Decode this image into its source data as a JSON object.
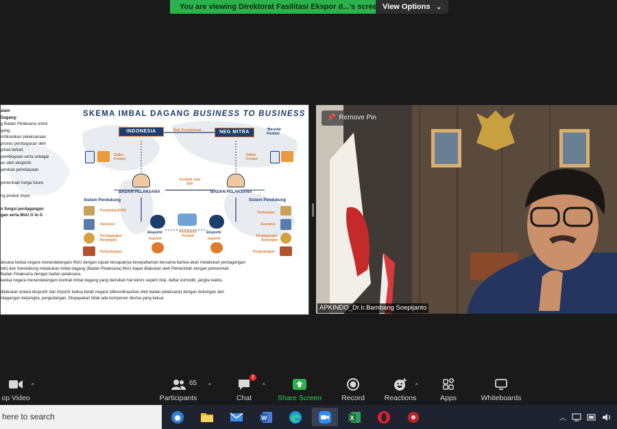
{
  "banner": {
    "message": "You are viewing Direktorat Fasilitasi Ekspor d...'s screen",
    "view_options": "View Options",
    "colors": {
      "green": "#2bb24c"
    }
  },
  "slide": {
    "title_main": "SKEMA IMBAL DAGANG ",
    "title_italic": "BUSINESS TO BUSINESS",
    "left_text": [
      "alam",
      "Dagang:",
      "g Badan Pelaksana untuk",
      "gang.",
      "ordinasikan pelaksanaan",
      "proses pembayaran oleh",
      "pihak terkait.",
      "pembiayaan serta sebagai",
      "an oleh eksportir.",
      "jaminan pembiayaan",
      "",
      "penentuan harga future",
      "",
      "ng produk impor",
      "",
      "n fungsi perdagangan",
      "gan serta MoU G to G"
    ],
    "box_indonesia": "INDONESIA",
    "box_negmitra": "NEG MITRA",
    "label_mou": "MoU Kondisional",
    "label_bersifat": "*Bersifat Flexibel",
    "label_daftar_left": "Daftar Produk",
    "label_daftar_right": "Daftar Produk",
    "label_kontrak": "Kontrak Jual Beli",
    "label_badan_left": "BADAN PELAKSANA",
    "label_badan_right": "BADAN PELAKSANA",
    "sistem_left": "Sistem Pendukung",
    "sistem_right": "Sistem Pendukung",
    "support_items": [
      "Perbankan/LPEI",
      "Asuransi",
      "Perdagangan Berjangka",
      "Pergudangan"
    ],
    "support_items_right": [
      "Perbankan",
      "Asuransi",
      "Perdagangan Berjangka",
      "Pergudangan"
    ],
    "eksportir_left": "Eksportir",
    "importir_left": "Importir",
    "eksportir_right": "Eksportir",
    "importir_right": "Importir",
    "pertukaran": "Pertukaran Produk",
    "bottom_text": [
      "aksana kedua negara menandatangani MoU dengan tujuan tercapainya kesepahaman bersama bahwa akan melakukan perdagangan",
      "tah) dan mendukung melakukan imbal dagang  (Badan Pelaksana) MoU dapat dilakukan oleh Pemerintah dengan pemerintah",
      "  Badan Pelaksana dengan badan pelaksana.",
      "kedua negara menandatangani kontrak  imbal dagang yang berisikan hal teknis seperti nilai, daftar komoditi, jangka waktu,",
      "",
      "dilakukan antara eksportir dan importir kedua belah negara (dikoordinasikan oleh badan pelaksana) dengan dukungan dari",
      "rdagangan berjangka, pergudangan. Diupayakan tidak ada komponen devisa yang keluar"
    ],
    "colors": {
      "navy": "#1d3d6d",
      "orange": "#e07a2c"
    }
  },
  "video": {
    "remove_pin": "Remove Pin",
    "participant_name": "APKINDO_Dr.Ir.Bambang Soepijanto"
  },
  "toolbar": {
    "stop_video": "op Video",
    "participants": "Participants",
    "participants_count": "65",
    "chat": "Chat",
    "chat_badge": "1",
    "share_screen": "Share Screen",
    "record": "Record",
    "reactions": "Reactions",
    "apps": "Apps",
    "whiteboards": "Whiteboards"
  },
  "taskbar": {
    "search_placeholder": "here to search",
    "apps": [
      "edge-legacy",
      "file-explorer",
      "mail",
      "word",
      "edge",
      "zoom",
      "excel",
      "opera",
      "app-red"
    ]
  }
}
